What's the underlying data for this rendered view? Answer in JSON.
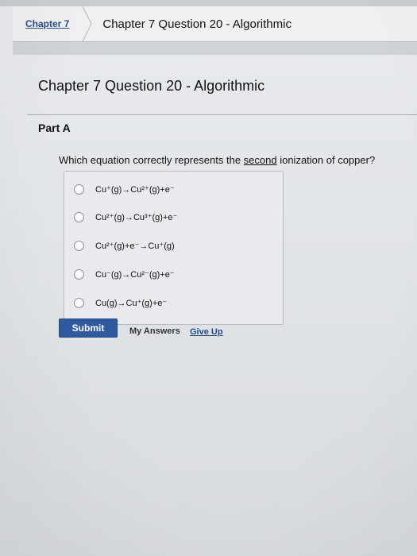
{
  "breadcrumb": {
    "link_label": "Chapter 7",
    "current_label": "Chapter 7 Question 20 - Algorithmic"
  },
  "main": {
    "title": "Chapter 7 Question 20 - Algorithmic",
    "part_label": "Part A",
    "question": {
      "before": "Which equation correctly represents the ",
      "emphasis": "second",
      "after": " ionization of copper?"
    },
    "options": [
      {
        "text": "Cu⁺(g)→Cu²⁺(g)+e⁻"
      },
      {
        "text": "Cu²⁺(g)→Cu³⁺(g)+e⁻"
      },
      {
        "text": "Cu²⁺(g)+e⁻→Cu⁺(g)"
      },
      {
        "text": "Cu⁻(g)→Cu²⁻(g)+e⁻"
      },
      {
        "text": "Cu(g)→Cu⁺(g)+e⁻"
      }
    ],
    "actions": {
      "submit_label": "Submit",
      "my_answers_label": "My Answers",
      "give_up_label": "Give Up"
    }
  },
  "colors": {
    "submit_bg": "#2f5aa0",
    "link": "#1f4b8c"
  }
}
